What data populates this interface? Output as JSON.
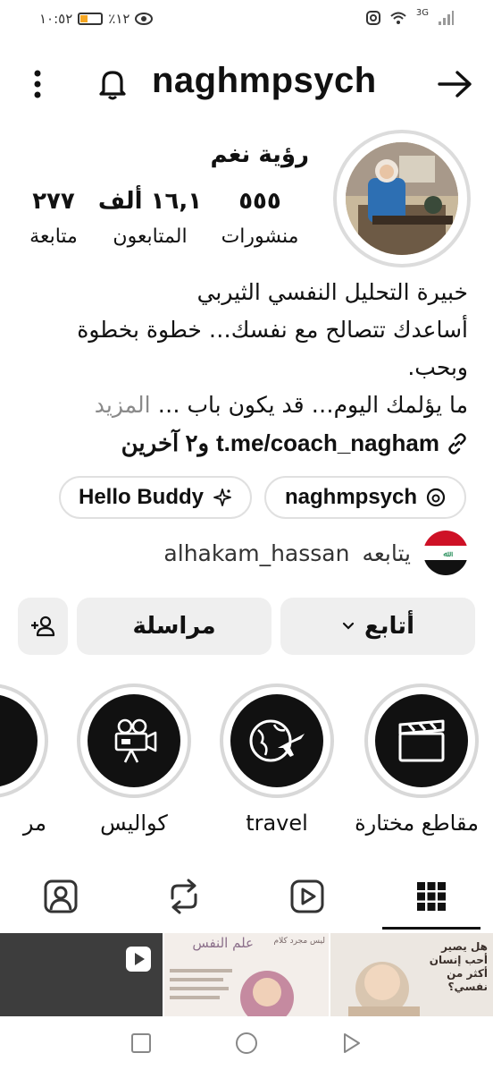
{
  "status_bar": {
    "time": "١٠:٥٢",
    "battery": "٪١٢",
    "battery_level": 0.12,
    "network": "3G"
  },
  "header": {
    "username": "naghmpsych"
  },
  "profile": {
    "display_name": "رؤية نغم",
    "stats": [
      {
        "value": "٥٥٥",
        "label": "منشورات"
      },
      {
        "value": "١٦,١ ألف",
        "label": "المتابعون"
      },
      {
        "value": "٢٧٧",
        "label": "متابعة"
      }
    ],
    "bio_lines": [
      "خبيرة التحليل النفسي الثيربي",
      "أساعدك تتصالح مع نفسك… خطوة بخطوة وبحب.",
      "ما يؤلمك اليوم… قد يكون باب … "
    ],
    "bio_more": "المزيد",
    "link": "t.me/coach_nagham",
    "link_extra": "و٢ آخرين",
    "chips": [
      {
        "label": "naghmpsych",
        "icon": "threads-icon"
      },
      {
        "label": "Hello Buddy",
        "icon": "sparkle-icon"
      }
    ],
    "followed_by_text": "يتابعه",
    "followed_by_user": "alhakam_hassan"
  },
  "actions": {
    "follow": "أتابع",
    "message": "مراسلة"
  },
  "highlights": [
    {
      "label": "مقاطع مختارة",
      "icon": "clapperboard-icon"
    },
    {
      "label": "travel",
      "icon": "globe-plane-icon"
    },
    {
      "label": "كواليس",
      "icon": "movie-camera-icon"
    },
    {
      "label": "مر",
      "icon": "partial-icon"
    }
  ],
  "tabs": [
    {
      "name": "grid",
      "icon": "grid-icon"
    },
    {
      "name": "reels",
      "icon": "reels-icon"
    },
    {
      "name": "reposts",
      "icon": "repost-icon"
    },
    {
      "name": "tagged",
      "icon": "tagged-icon"
    }
  ],
  "posts": [
    {
      "title": "هل يصير أحب إنسان أكثر من نفسي؟"
    },
    {
      "title": "علم النفس",
      "subtitle": "ليس مجرد كلام"
    },
    {
      "title": "",
      "video": true
    }
  ],
  "colors": {
    "chip_border": "#e0e0e0",
    "button_bg": "#efefef",
    "muted_text": "#8a8a8a"
  }
}
